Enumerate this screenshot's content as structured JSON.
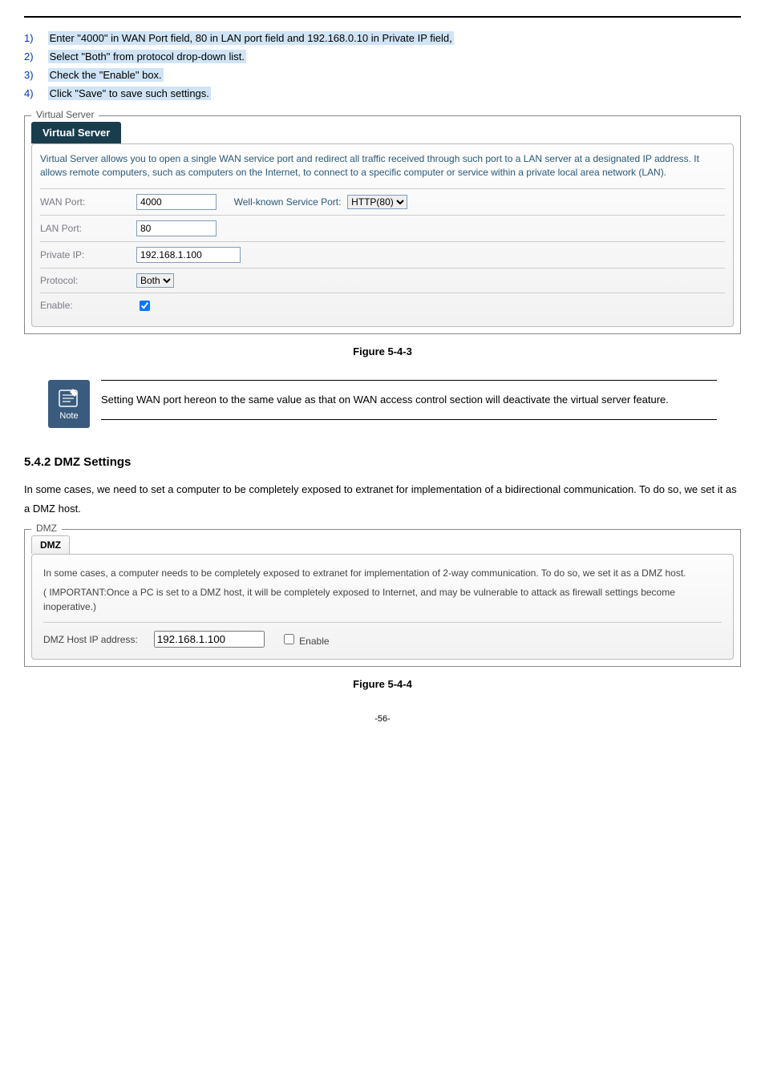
{
  "steps": [
    {
      "num": "1)",
      "text": "Enter \"4000\" in WAN Port field, 80 in LAN port field and 192.168.0.10 in Private IP field, "
    },
    {
      "num": "2)",
      "text": "Select \"Both\" from protocol drop-down list."
    },
    {
      "num": "3)",
      "text": "Check the \"Enable\" box."
    },
    {
      "num": "4)",
      "text": "Click \"Save\" to save such settings."
    }
  ],
  "vs": {
    "outer_tab": "Virtual Server",
    "dark_tab": "Virtual Server",
    "intro": "Virtual Server allows you to open a single WAN service port and redirect all traffic received through such port to a LAN server at a designated IP address. It allows remote computers, such as computers on the Internet, to connect to a specific computer or service within a private local area network (LAN).",
    "rows": {
      "wan_label": "WAN Port:",
      "wan_value": "4000",
      "well_known_label": "Well-known Service Port:",
      "well_known_value": "HTTP(80)",
      "lan_label": "LAN Port:",
      "lan_value": "80",
      "private_label": "Private IP:",
      "private_value": "192.168.1.100",
      "protocol_label": "Protocol:",
      "protocol_value": "Both",
      "enable_label": "Enable:"
    }
  },
  "fig1": "Figure 5-4-3",
  "note": {
    "icon_label": "Note",
    "text": "Setting WAN port hereon to the same value as that on WAN access control section will deactivate the virtual server feature."
  },
  "section_title": "5.4.2  DMZ Settings",
  "section_intro": "In some cases, we need to set a computer to be completely exposed to extranet for implementation of a bidirectional communication. To do so, we set it as a DMZ host.",
  "dmz": {
    "outer_tab": "DMZ",
    "inner_tab": "DMZ",
    "p1": "In some cases, a computer needs to be completely exposed to extranet for implementation of 2-way communication. To do so, we set it as a DMZ host.",
    "p2": "( IMPORTANT:Once a PC is set to a DMZ host, it will be completely exposed to Internet, and may be vulnerable to attack as firewall settings become inoperative.)",
    "host_label": "DMZ Host IP address:",
    "host_value": "192.168.1.100",
    "enable_label": "Enable"
  },
  "fig2": "Figure 5-4-4",
  "page_num": "-56-"
}
